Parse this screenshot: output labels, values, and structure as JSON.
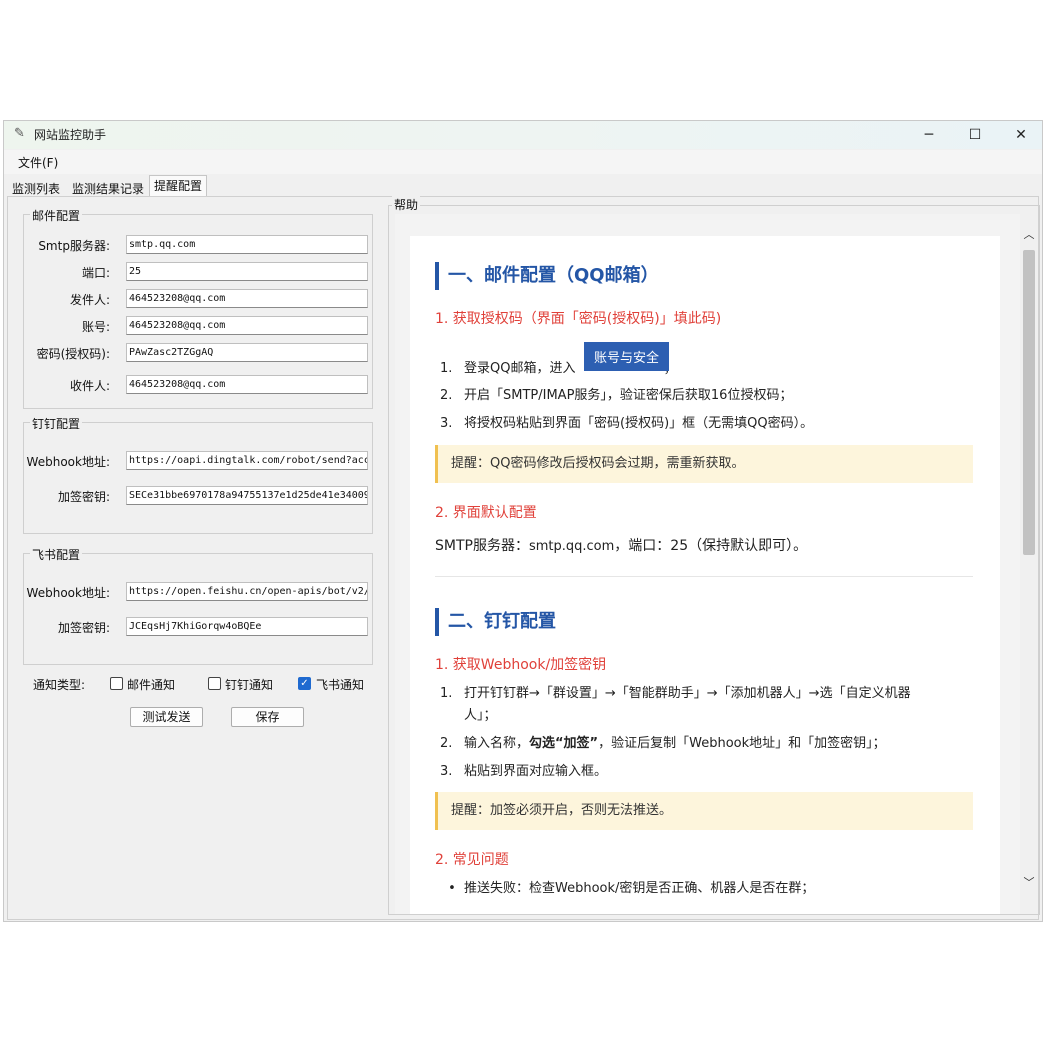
{
  "window": {
    "title": "网站监控助手",
    "controls": {
      "minimize": "─",
      "maximize": "☐",
      "close": "✕"
    }
  },
  "menu": {
    "file": "文件(F)"
  },
  "tabs": [
    "监测列表",
    "监测结果记录",
    "提醒配置"
  ],
  "active_tab": 2,
  "email": {
    "title": "邮件配置",
    "smtp_label": "Smtp服务器:",
    "smtp_value": "smtp.qq.com",
    "port_label": "端口:",
    "port_value": "25",
    "sender_label": "发件人:",
    "sender_value": "464523208@qq.com",
    "account_label": "账号:",
    "account_value": "464523208@qq.com",
    "password_label": "密码(授权码):",
    "password_value": "PAwZasc2TZGgAQ",
    "receiver_label": "收件人:",
    "receiver_value": "464523208@qq.com"
  },
  "dingtalk": {
    "title": "钉钉配置",
    "webhook_label": "Webhook地址:",
    "webhook_value": "https://oapi.dingtalk.com/robot/send?acc",
    "secret_label": "加签密钥:",
    "secret_value": "SECe31bbe6970178a94755137e1d25de41e34009"
  },
  "feishu": {
    "title": "飞书配置",
    "webhook_label": "Webhook地址:",
    "webhook_value": "https://open.feishu.cn/open-apis/bot/v2/",
    "secret_label": "加签密钥:",
    "secret_value": "JCEqsHj7KhiGorqw4oBQEe"
  },
  "notify": {
    "label": "通知类型:",
    "email": {
      "label": "邮件通知",
      "checked": false
    },
    "dingtalk": {
      "label": "钉钉通知",
      "checked": false
    },
    "feishu": {
      "label": "飞书通知",
      "checked": true
    }
  },
  "buttons": {
    "test_send": "测试发送",
    "save": "保存"
  },
  "help": {
    "title": "帮助",
    "section1": {
      "heading": "一、邮件配置（QQ邮箱）",
      "sub1": "1. 获取授权码（界面「密码(授权码)」填此码)",
      "step1_num": "1.",
      "step1_a": "登录QQ邮箱，进入",
      "step1_chip": "账号与安全",
      "step1_b": "；",
      "step2_num": "2.",
      "step2": "开启「SMTP/IMAP服务」，验证密保后获取16位授权码；",
      "step3_num": "3.",
      "step3": "将授权码粘贴到界面「密码(授权码)」框（无需填QQ密码）。",
      "tip": "提醒：QQ密码修改后授权码会过期，需重新获取。",
      "sub2": "2. 界面默认配置",
      "default_a": "SMTP服务器：",
      "default_b": "smtp.qq.com",
      "default_c": "，端口：25（保持默认即可）。"
    },
    "section2": {
      "heading": "二、钉钉配置",
      "sub1": "1. 获取Webhook/加签密钥",
      "step1_num": "1.",
      "step1_line1": "打开钉钉群→「群设置」→「智能群助手」→「添加机器人」→选「自定义机器",
      "step1_line2": "人」；",
      "step2_num": "2.",
      "step2_a": "输入名称，",
      "step2_bold": "勾选“加签”",
      "step2_b": "，验证后复制「Webhook地址」和「加签密钥」；",
      "step3_num": "3.",
      "step3": "粘贴到界面对应输入框。",
      "tip": "提醒：加签必须开启，否则无法推送。",
      "sub2": "2. 常见问题",
      "faq1": "推送失败：检查Webhook/密钥是否正确、机器人是否在群；"
    }
  }
}
